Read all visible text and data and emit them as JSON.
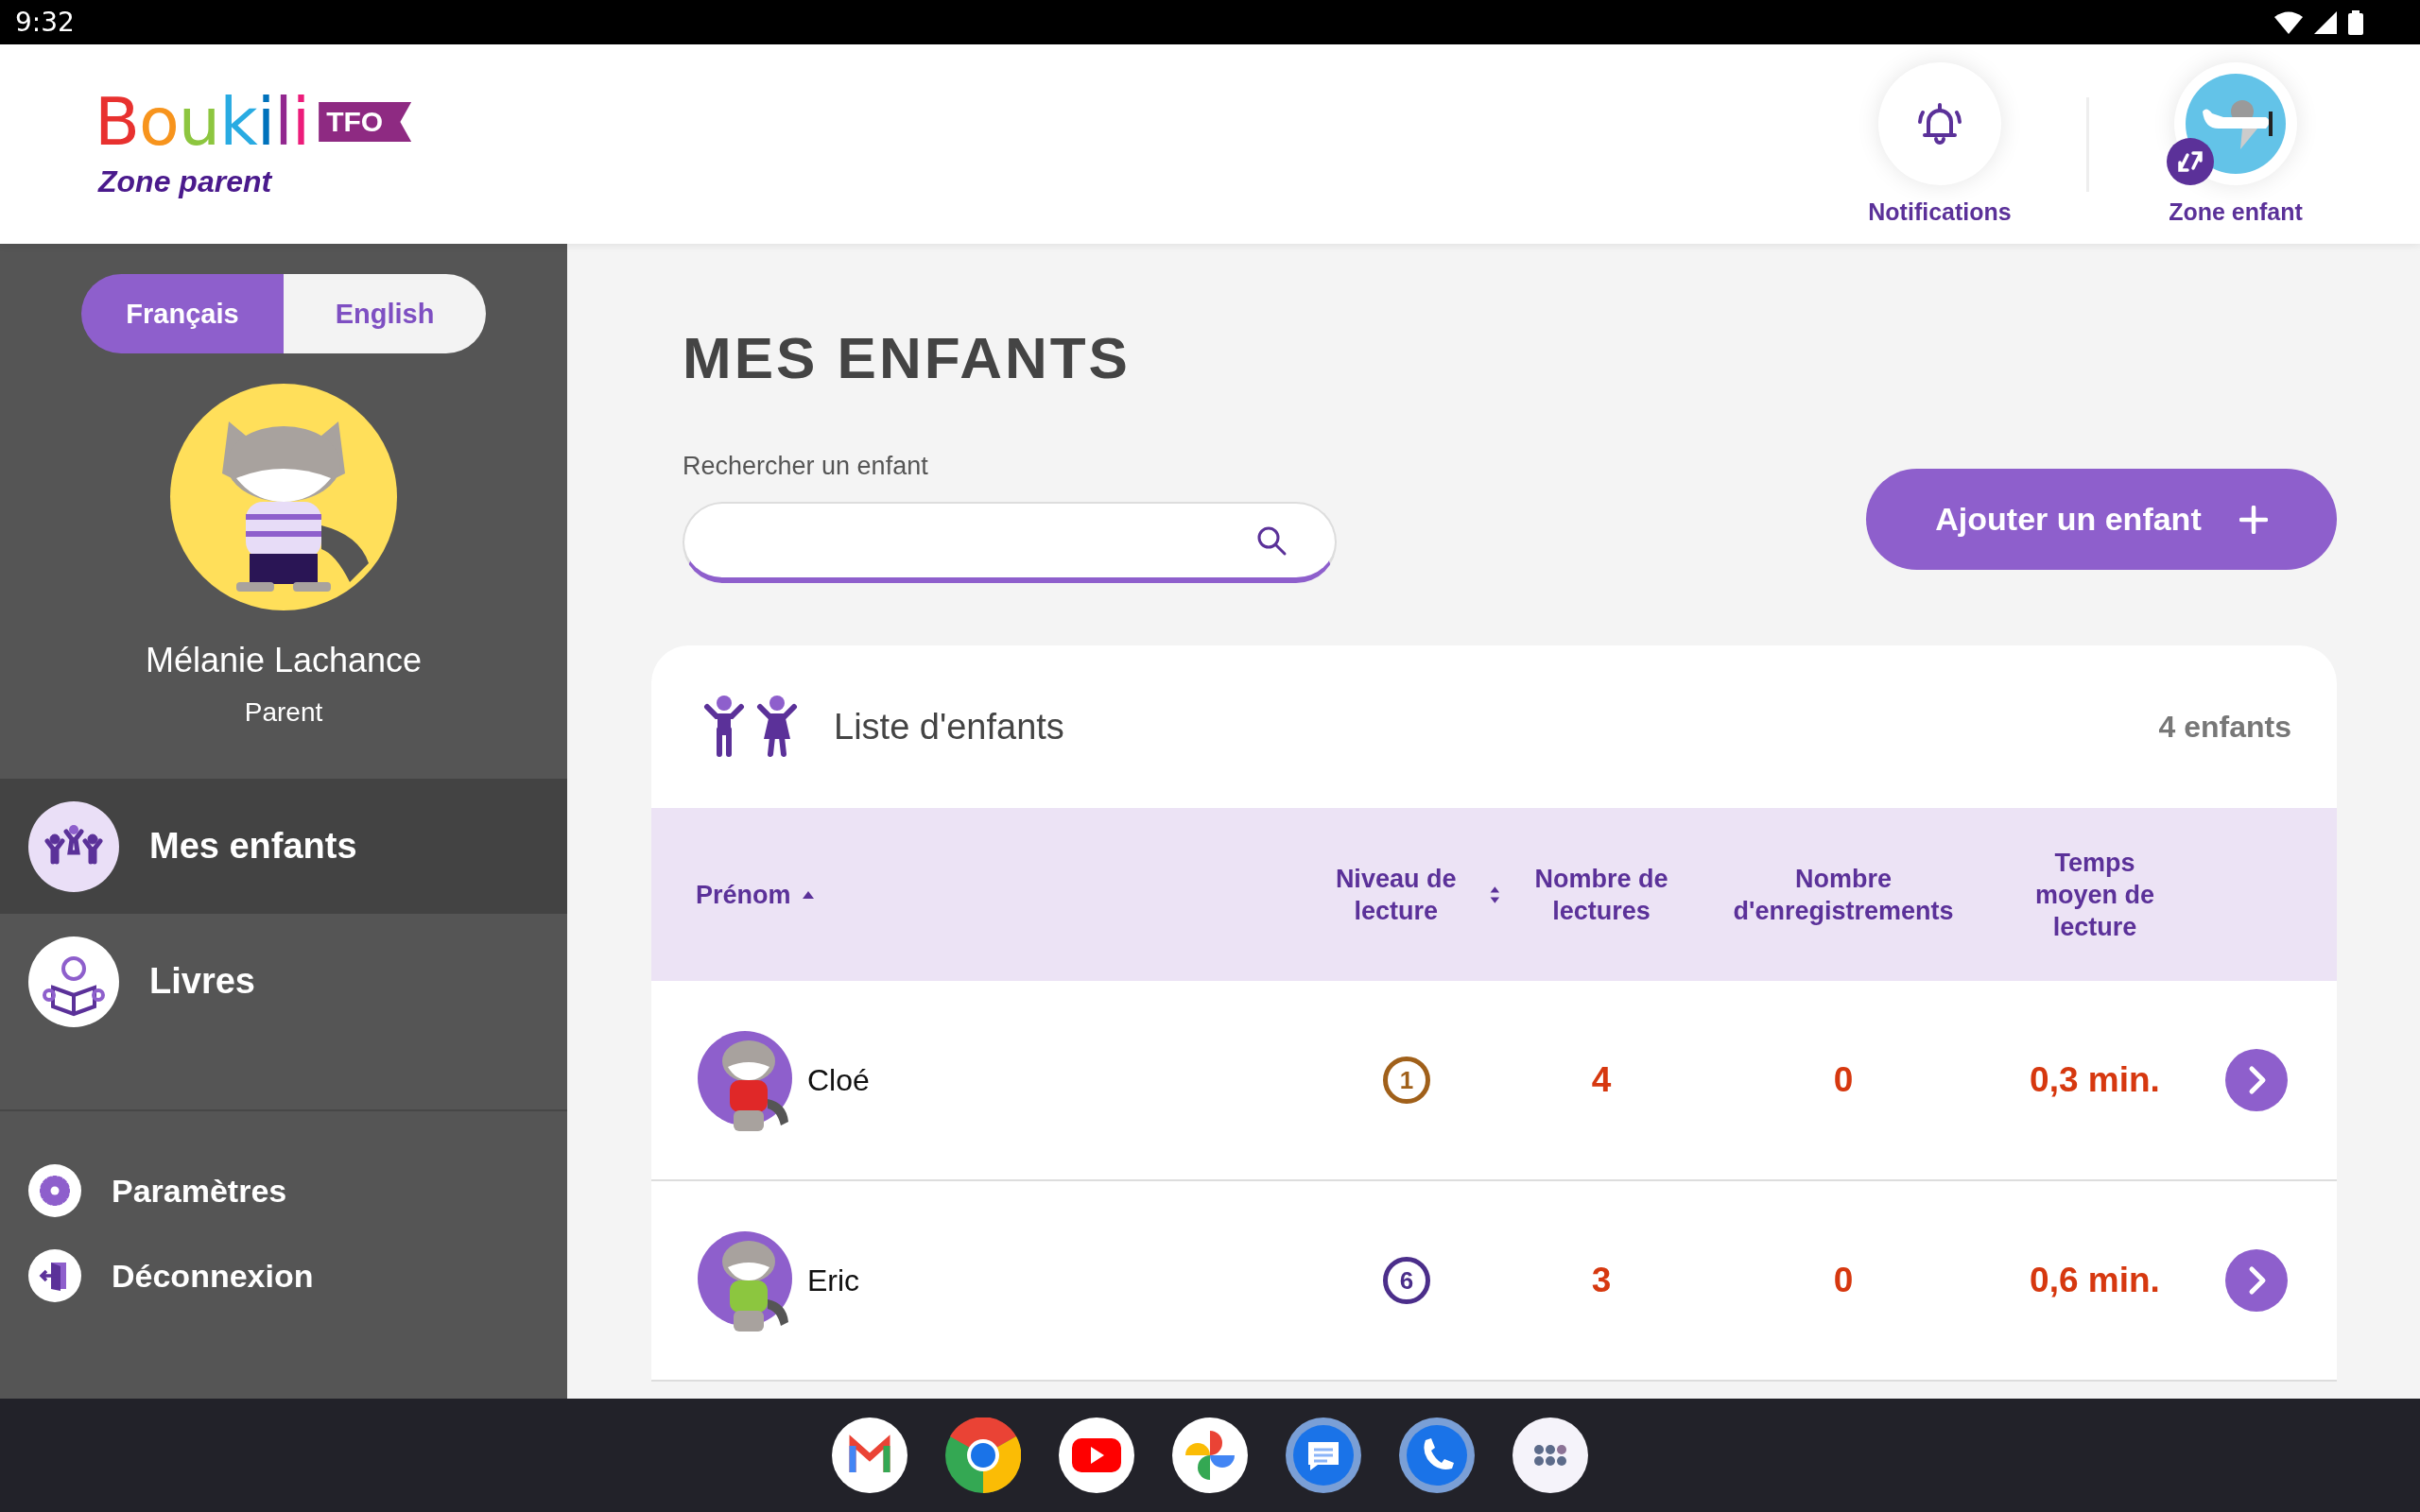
{
  "status_bar": {
    "time": "9:32"
  },
  "header": {
    "logo": {
      "wordmark": "Boukili",
      "badge": "TFO",
      "subtitle": "Zone parent"
    },
    "actions": [
      {
        "kind": "bell",
        "label": "Notifications"
      },
      {
        "kind": "child_zone",
        "label": "Zone enfant"
      }
    ]
  },
  "sidebar": {
    "languages": [
      {
        "label": "Français",
        "selected": true
      },
      {
        "label": "English",
        "selected": false
      }
    ],
    "profile": {
      "name": "Mélanie Lachance",
      "role": "Parent"
    },
    "nav": [
      {
        "kind": "children",
        "label": "Mes enfants",
        "selected": true
      },
      {
        "kind": "reader",
        "label": "Livres",
        "selected": false
      }
    ],
    "footer": [
      {
        "kind": "gear",
        "label": "Paramètres"
      },
      {
        "kind": "logout",
        "label": "Déconnexion"
      }
    ]
  },
  "main": {
    "title": "MES ENFANTS",
    "search": {
      "label": "Rechercher un enfant"
    },
    "add_button": {
      "label": "Ajouter un enfant"
    },
    "list": {
      "title": "Liste d'enfants",
      "count": "4 enfants",
      "columns": [
        {
          "label": "Prénom",
          "kind": "sorted"
        },
        {
          "label": "Niveau de lecture",
          "kind": "sortable"
        },
        {
          "label": "Nombre de lectures",
          "kind": "plain"
        },
        {
          "label": "Nombre d'enregistrements",
          "kind": "plain"
        },
        {
          "label": "Temps moyen de lecture",
          "kind": "plain"
        }
      ],
      "rows": [
        {
          "name": "Cloé",
          "level": "1",
          "color": "#a0601a",
          "readings": "4",
          "recordings": "0",
          "avg_time": "0,3 min."
        },
        {
          "name": "Eric",
          "level": "6",
          "color": "#4b2e8a",
          "readings": "3",
          "recordings": "0",
          "avg_time": "0,6 min."
        }
      ]
    }
  },
  "taskbar": {
    "apps": [
      {
        "kind": "mail"
      },
      {
        "kind": "browser"
      },
      {
        "kind": "video"
      },
      {
        "kind": "photos"
      },
      {
        "kind": "messages"
      },
      {
        "kind": "phone"
      },
      {
        "kind": "apps"
      }
    ]
  }
}
